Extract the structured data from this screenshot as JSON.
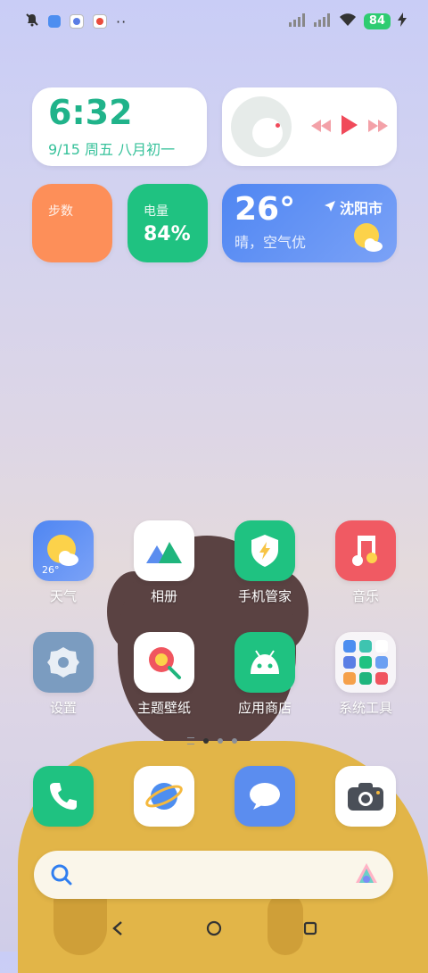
{
  "status_bar": {
    "battery": "84",
    "overflow": "··"
  },
  "widgets": {
    "clock": {
      "time": "6:32",
      "date": "9/15 周五 八月初一"
    },
    "steps": {
      "label": "步数"
    },
    "battery": {
      "label": "电量",
      "value": "84%"
    },
    "weather": {
      "temp": "26°",
      "desc": "晴，空气优",
      "city": "沈阳市"
    }
  },
  "apps": [
    {
      "label": "天气",
      "badge": "26°"
    },
    {
      "label": "相册"
    },
    {
      "label": "手机管家"
    },
    {
      "label": "音乐"
    },
    {
      "label": "设置"
    },
    {
      "label": "主题壁纸"
    },
    {
      "label": "应用商店"
    },
    {
      "label": "系统工具"
    }
  ],
  "dock": [
    "phone",
    "browser",
    "messages",
    "camera"
  ],
  "colors": {
    "clock_green": "#20b38a",
    "steps_orange": "#fd8f59",
    "battery_green": "#1fc281",
    "weather_blue": "#4f86f2",
    "music_red": "#f04a5a"
  }
}
